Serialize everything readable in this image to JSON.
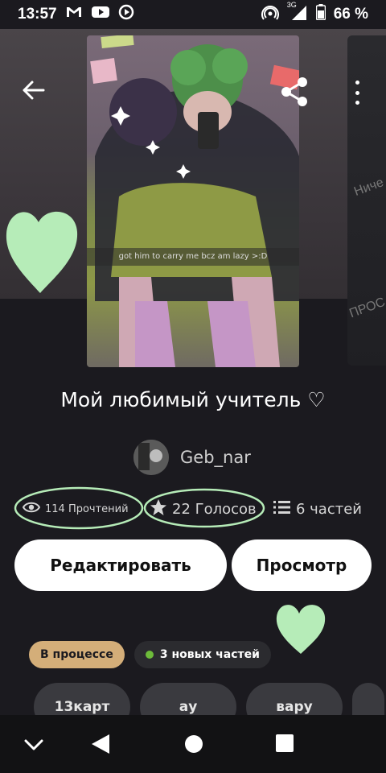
{
  "status_bar": {
    "time": "13:57",
    "battery_percent": "66 %",
    "network": "3G",
    "icons": [
      "gmail-icon",
      "youtube-icon",
      "media-icon",
      "hotspot-icon",
      "signal-icon",
      "battery-icon"
    ]
  },
  "header": {
    "back_icon": "arrow-back-icon",
    "share_icon": "share-icon",
    "more_icon": "more-vertical-icon"
  },
  "cover": {
    "caption": "got him to carry me bcz am lazy >:D"
  },
  "story": {
    "title": "Мой любимый учитель ♡",
    "author": "Geb_nar"
  },
  "stats": {
    "reads": "114 Прочтений",
    "votes": "22 Голосов",
    "parts": "6 частей"
  },
  "actions": {
    "edit_label": "Редактировать",
    "view_label": "Просмотр"
  },
  "badges": {
    "status": "В процессе",
    "new_parts": "3 новых частей"
  },
  "tags": [
    "13карт",
    "ау",
    "вару",
    ""
  ],
  "colors": {
    "background": "#1b1a1f",
    "button_bg": "#ffffff",
    "status_badge": "#d4ae79",
    "new_dot": "#6dbb3a",
    "doodle_green": "#b6ecb8"
  }
}
